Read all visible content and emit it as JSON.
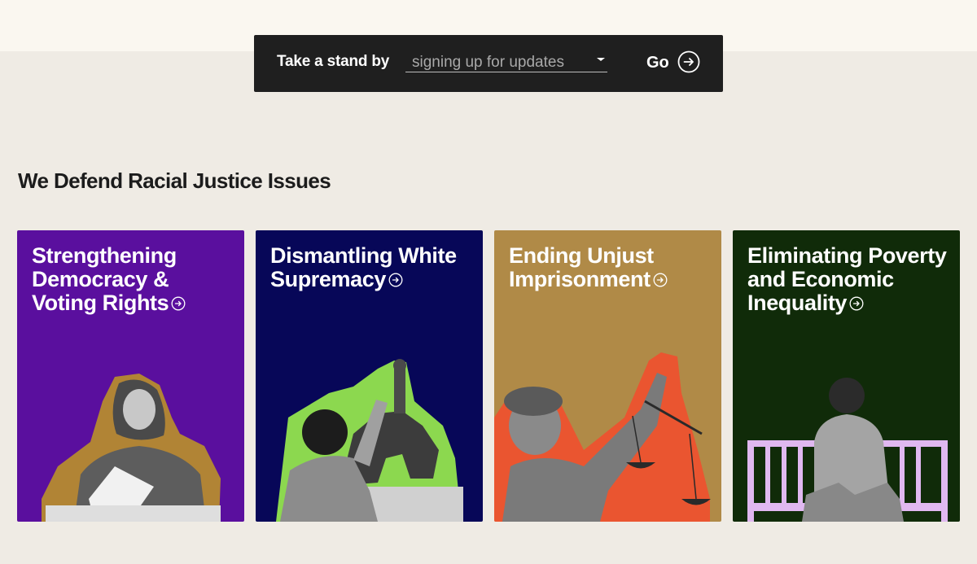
{
  "cta": {
    "label": "Take a stand by",
    "selected_option": "signing up for updates",
    "go_label": "Go"
  },
  "section": {
    "heading": "We Defend Racial Justice Issues"
  },
  "cards": [
    {
      "title": "Strengthening Democracy & Voting Rights",
      "bg": "#5a0f9e",
      "accent": "#b18435"
    },
    {
      "title": "Dismantling White Supremacy",
      "bg": "#070758",
      "accent": "#8cd84f"
    },
    {
      "title": "Ending Unjust Imprisonment",
      "bg": "#b08a47",
      "accent": "#ea5530"
    },
    {
      "title": "Eliminating Poverty and Economic Inequality",
      "bg": "#102b09",
      "accent": "#e0b8f0"
    }
  ],
  "icons": {
    "caret": "chevron-down-icon",
    "go": "arrow-right-circle-icon",
    "card_arrow": "arrow-right-circle-icon"
  }
}
